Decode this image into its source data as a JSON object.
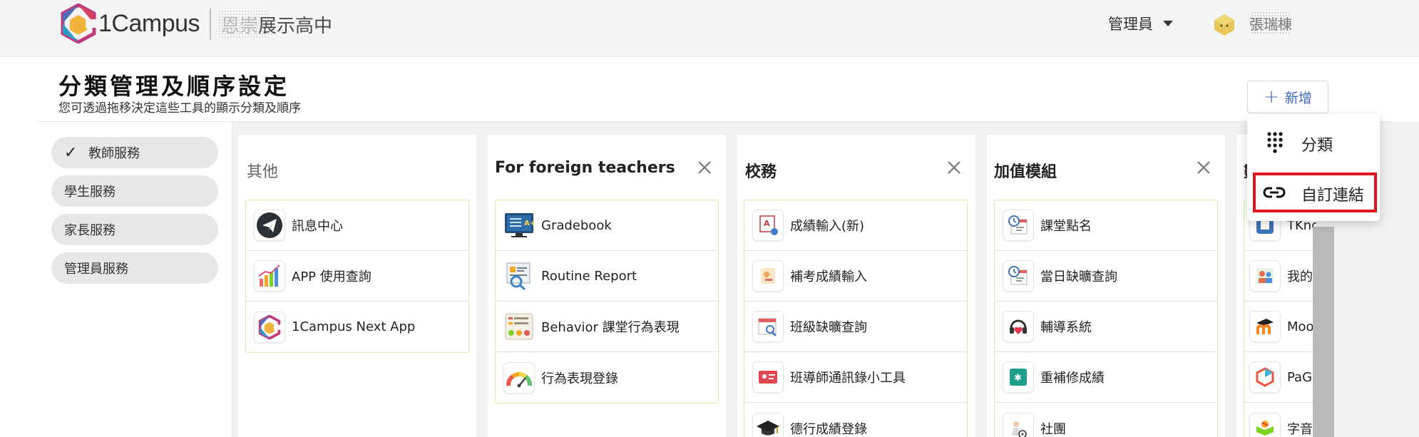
{
  "header": {
    "brand": "1Campus",
    "school_hidden": "恩崇",
    "school_visible": "展示高中",
    "admin_label": "管理員",
    "user_name": "張瑞棟"
  },
  "page": {
    "title": "分類管理及順序設定",
    "subtitle": "您可透過拖移決定這些工具的顯示分類及順序",
    "add_button": "新增"
  },
  "dropdown": {
    "items": [
      {
        "label": "分類",
        "icon": "grid-dots-icon"
      },
      {
        "label": "自訂連結",
        "icon": "link-icon",
        "highlighted": true
      }
    ]
  },
  "sidebar": {
    "items": [
      {
        "label": "教師服務",
        "selected": true
      },
      {
        "label": "學生服務"
      },
      {
        "label": "家長服務"
      },
      {
        "label": "管理員服務"
      }
    ]
  },
  "columns": [
    {
      "title": "其他",
      "closable": false,
      "cards": [
        {
          "label": "訊息中心",
          "icon": "paper-plane-icon"
        },
        {
          "label": "APP 使用查詢",
          "icon": "bar-chart-icon"
        },
        {
          "label": "1Campus Next App",
          "icon": "1campus-logo-icon"
        }
      ]
    },
    {
      "title": "For foreign teachers",
      "closable": true,
      "cards": [
        {
          "label": "Gradebook",
          "icon": "gradebook-icon"
        },
        {
          "label": "Routine Report",
          "icon": "report-icon"
        },
        {
          "label": "Behavior 課堂行為表現",
          "icon": "behavior-icon"
        },
        {
          "label": "行為表現登錄",
          "icon": "gauge-icon"
        }
      ]
    },
    {
      "title": "校務",
      "closable": true,
      "cards": [
        {
          "label": "成績輸入(新)",
          "icon": "grade-input-icon"
        },
        {
          "label": "補考成績輸入",
          "icon": "makeup-exam-icon"
        },
        {
          "label": "班級缺曠查詢",
          "icon": "attendance-search-icon"
        },
        {
          "label": "班導師通訊錄小工具",
          "icon": "contact-card-icon"
        },
        {
          "label": "德行成績登錄",
          "icon": "graduation-cap-icon"
        }
      ]
    },
    {
      "title": "加值模組",
      "closable": true,
      "cards": [
        {
          "label": "課堂點名",
          "icon": "clock-calendar-icon"
        },
        {
          "label": "當日缺曠查詢",
          "icon": "clock-calendar-icon"
        },
        {
          "label": "輔導系統",
          "icon": "headphones-heart-icon"
        },
        {
          "label": "重補修成績",
          "icon": "green-tile-icon"
        },
        {
          "label": "社團",
          "icon": "club-icon"
        }
      ]
    },
    {
      "title": "數",
      "closable": false,
      "cards": [
        {
          "label": "TKno",
          "icon": "tknow-icon"
        },
        {
          "label": "我的",
          "icon": "people-icon"
        },
        {
          "label": "Moo",
          "icon": "moodle-icon"
        },
        {
          "label": "PaGa",
          "icon": "pagamo-icon"
        },
        {
          "label": "字音",
          "icon": "book-icon"
        }
      ]
    }
  ]
}
